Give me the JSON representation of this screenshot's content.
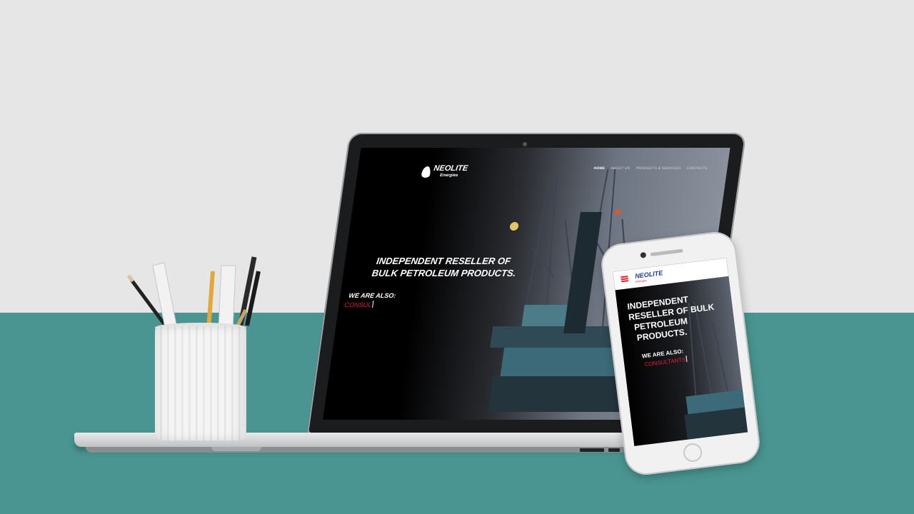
{
  "site": {
    "logo_name": "NEOLITE",
    "logo_sub": "Energies",
    "nav": [
      "HOME",
      "ABOUT US",
      "PRODUCTS & SERVICES",
      "CONTACTS"
    ],
    "hero_line1": "INDEPENDENT RESELLER OF",
    "hero_line2": "BULK PETROLEUM PRODUCTS.",
    "also_label": "WE ARE ALSO:",
    "typed_word": "CONSUL"
  },
  "mobile": {
    "logo_name": "NEOLITE",
    "logo_sub": "Energies",
    "hero_line1": "INDEPENDENT",
    "hero_line2": "RESELLER OF BULK",
    "hero_line3": "PETROLEUM",
    "hero_line4": "PRODUCTS.",
    "also_label": "WE ARE ALSO:",
    "typed_word": "CONSULTANTS"
  },
  "colors": {
    "wall": "#e6e6e6",
    "desk": "#4a9591",
    "accent_red": "#e0212f",
    "brand_blue": "#1c3d8a"
  }
}
